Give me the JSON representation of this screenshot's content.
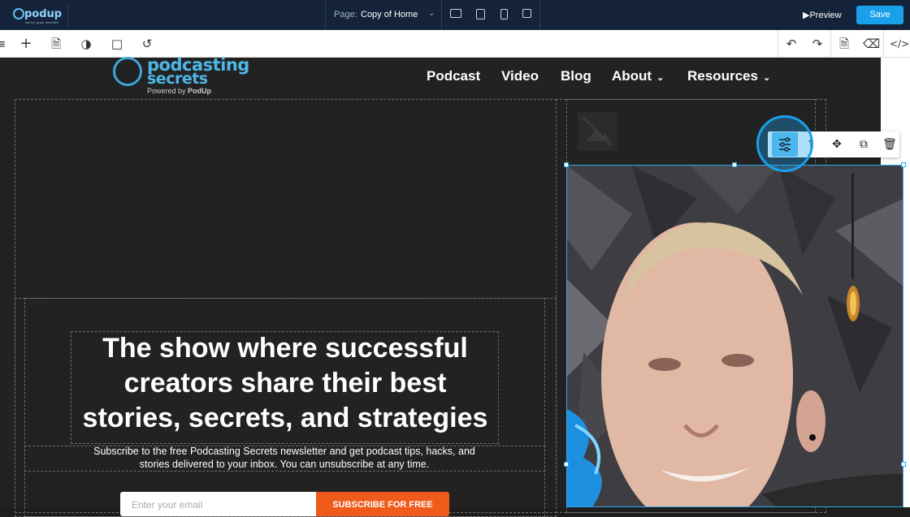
{
  "topbar": {
    "brand": "podup",
    "brand_tagline": "launch. grow. monetize.",
    "page_label": "Page:",
    "page_value": "Copy of Home",
    "preview_label": "Preview",
    "save_label": "Save"
  },
  "toolbar": {
    "left_icons": [
      "hamburger-icon",
      "plus-icon",
      "page-icon",
      "palette-icon",
      "bookmark-icon",
      "history-icon"
    ],
    "right_icons": [
      "undo-icon",
      "redo-icon",
      "export-icon",
      "eraser-icon",
      "code-icon"
    ]
  },
  "site": {
    "logo_line1": "podcasting",
    "logo_line2": "secrets",
    "logo_powered": "Powered by ",
    "logo_powered_brand": "PodUp",
    "nav": [
      "Podcast",
      "Video",
      "Blog",
      "About",
      "Resources"
    ],
    "headline": "The show where successful creators share their best stories, secrets, and strategies",
    "subtext": "Subscribe to the free Podcasting Secrets newsletter and get podcast tips, hacks, and stories delivered to your inbox. You can unsubscribe at any time.",
    "email_placeholder": "Enter your email",
    "subscribe_label": "SUBSCRIBE FOR FREE"
  },
  "element_toolbar": {
    "icons": [
      "settings-sliders-icon",
      "select-parent-icon",
      "move-icon",
      "duplicate-icon",
      "delete-icon"
    ]
  },
  "colors": {
    "topbar_bg": "#14233a",
    "accent": "#1aa0ea",
    "subscribe": "#f05a1a"
  }
}
